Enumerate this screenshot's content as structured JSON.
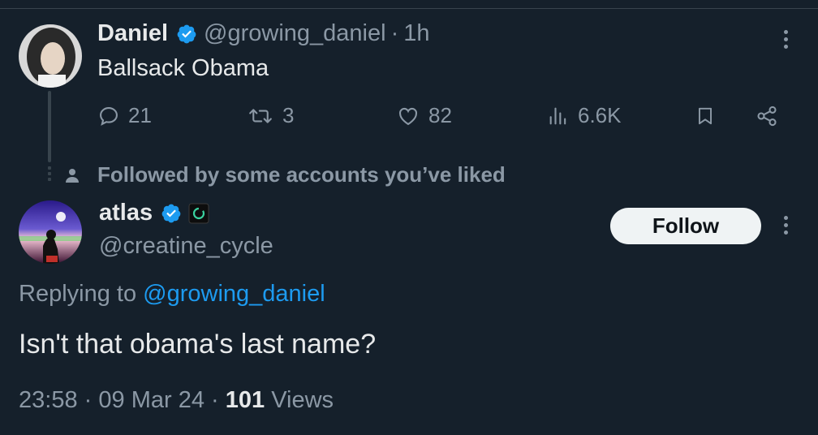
{
  "parent_tweet": {
    "display_name": "Daniel",
    "handle": "@growing_daniel",
    "separator": "·",
    "time": "1h",
    "text": "Ballsack Obama",
    "stats": {
      "replies": "21",
      "retweets": "3",
      "likes": "82",
      "views": "6.6K"
    }
  },
  "social_context": "Followed by some accounts you’ve liked",
  "reply_tweet": {
    "display_name": "atlas",
    "handle": "@creatine_cycle",
    "follow_label": "Follow",
    "replying_prefix": "Replying to",
    "replying_to": "@growing_daniel",
    "text": "Isn't that obama's last name?",
    "time": "23:58",
    "date": "09 Mar 24",
    "separator": "·",
    "views_count": "101",
    "views_label": "Views"
  },
  "colors": {
    "background": "#15202b",
    "text": "#e7e9ea",
    "muted": "#8b98a5",
    "accent": "#1d9bf0",
    "verified": "#1d9bf0"
  },
  "icons": [
    "verified-badge-icon",
    "reply-icon",
    "retweet-icon",
    "like-icon",
    "views-icon",
    "bookmark-icon",
    "share-icon",
    "more-icon",
    "person-icon",
    "affiliate-badge-icon"
  ]
}
